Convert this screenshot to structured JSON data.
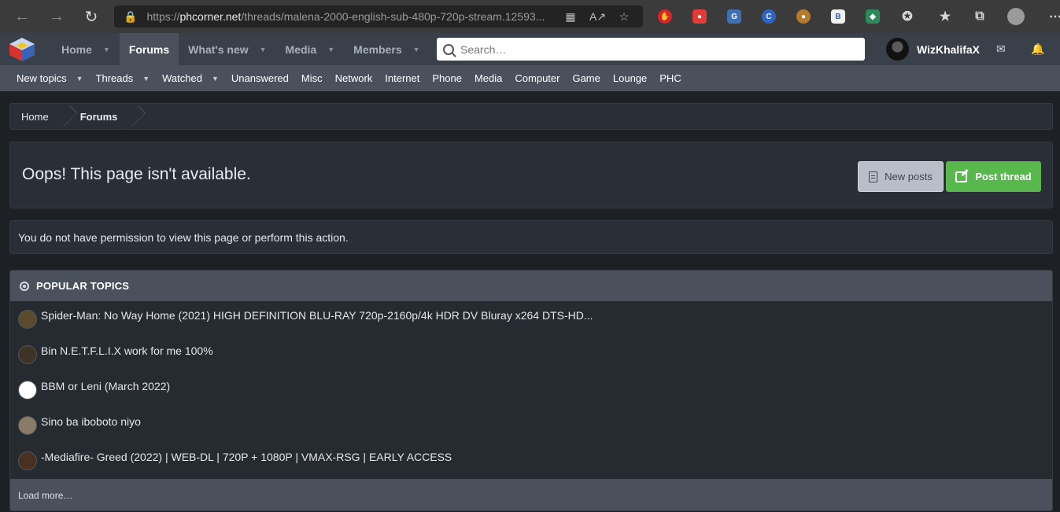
{
  "browser": {
    "url_host": "phcorner.net",
    "url_scheme": "https://",
    "url_path": "/threads/malena-2000-english-sub-480p-720p-stream.12593..."
  },
  "header": {
    "nav": [
      {
        "label": "Home",
        "has_caret": true,
        "selected": false
      },
      {
        "label": "Forums",
        "has_caret": false,
        "selected": true
      },
      {
        "label": "What's new",
        "has_caret": true,
        "selected": false
      },
      {
        "label": "Media",
        "has_caret": true,
        "selected": false
      },
      {
        "label": "Members",
        "has_caret": true,
        "selected": false
      }
    ],
    "search_placeholder": "Search…",
    "username": "WizKhalifaX"
  },
  "sub_nav": [
    {
      "label": "New topics",
      "has_caret": true
    },
    {
      "label": "Threads",
      "has_caret": true
    },
    {
      "label": "Watched",
      "has_caret": true
    },
    {
      "label": "Unanswered",
      "has_caret": false
    },
    {
      "label": "Misc",
      "has_caret": false
    },
    {
      "label": "Network",
      "has_caret": false
    },
    {
      "label": "Internet",
      "has_caret": false
    },
    {
      "label": "Phone",
      "has_caret": false
    },
    {
      "label": "Media",
      "has_caret": false
    },
    {
      "label": "Computer",
      "has_caret": false
    },
    {
      "label": "Game",
      "has_caret": false
    },
    {
      "label": "Lounge",
      "has_caret": false
    },
    {
      "label": "PHC",
      "has_caret": false
    }
  ],
  "breadcrumb": [
    "Home",
    "Forums"
  ],
  "page": {
    "title": "Oops! This page isn't available.",
    "new_posts_label": "New posts",
    "post_thread_label": "Post thread",
    "notice": "You do not have permission to view this page or perform this action."
  },
  "popular": {
    "heading": "POPULAR TOPICS",
    "topics": [
      {
        "title": "Spider-Man: No Way Home (2021) HIGH DEFINITION BLU-RAY 720p-2160p/4k HDR DV Bluray x264 DTS-HD...",
        "avatar_color": "#5b4a2e"
      },
      {
        "title": "Bin N.E.T.F.L.I.X work for me 100%",
        "avatar_color": "#3d3326"
      },
      {
        "title": "BBM or Leni (March 2022)",
        "avatar_color": "#ffffff"
      },
      {
        "title": "Sino ba iboboto niyo",
        "avatar_color": "#8a7a6a"
      },
      {
        "title": "-Mediafire- Greed (2022) | WEB-DL | 720P + 1080P | VMAX-RSG | EARLY ACCESS",
        "avatar_color": "#4a3020"
      }
    ],
    "load_more": "Load more…"
  },
  "colors": {
    "accent_green": "#58b74d",
    "header_bg": "#3a4049",
    "subnav_bg": "#4a515c"
  }
}
